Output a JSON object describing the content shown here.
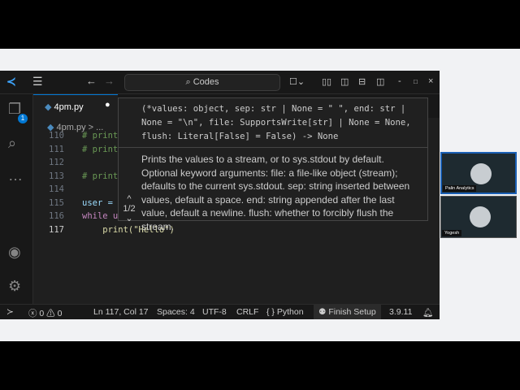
{
  "titlebar": {
    "search": "Codes"
  },
  "tabs": [
    {
      "label": "4pm.py"
    }
  ],
  "breadcrumb": {
    "file": "4pm.py",
    "sep": "> ..."
  },
  "code": [
    {
      "n": "110",
      "t": "# print"
    },
    {
      "n": "111",
      "t": "# print"
    },
    {
      "n": "112",
      "t": ""
    },
    {
      "n": "113",
      "t": "# print"
    },
    {
      "n": "114",
      "t": ""
    },
    {
      "n": "115",
      "t": "user = "
    },
    {
      "n": "116",
      "t": "while u"
    },
    {
      "n": "117",
      "t": "    print(\"Hello\")"
    }
  ],
  "hover": {
    "signature": "(*values: object, sep: str | None = \" \", end: str | None = \"\\n\", file: SupportsWrite[str] | None = None, flush: Literal[False] = False) -> None",
    "doc": "Prints the values to a stream, or to sys.stdout by default. Optional keyword arguments: file: a file-like object (stream); defaults to the current sys.stdout. sep: string inserted between values, default a space. end: string appended after the last value, default a newline. flush: whether to forcibly flush the stream.",
    "counter": "1/2"
  },
  "activity": {
    "badge": "1"
  },
  "status": {
    "errors": "0",
    "warnings": "0",
    "position": "Ln 117, Col 17",
    "spaces": "Spaces: 4",
    "encoding": "UTF-8",
    "eol": "CRLF",
    "language": "Python",
    "setup": "Finish Setup",
    "version": "3.9.11"
  },
  "participants": [
    {
      "name": "Palin Analytics"
    },
    {
      "name": "Yogesh"
    }
  ]
}
